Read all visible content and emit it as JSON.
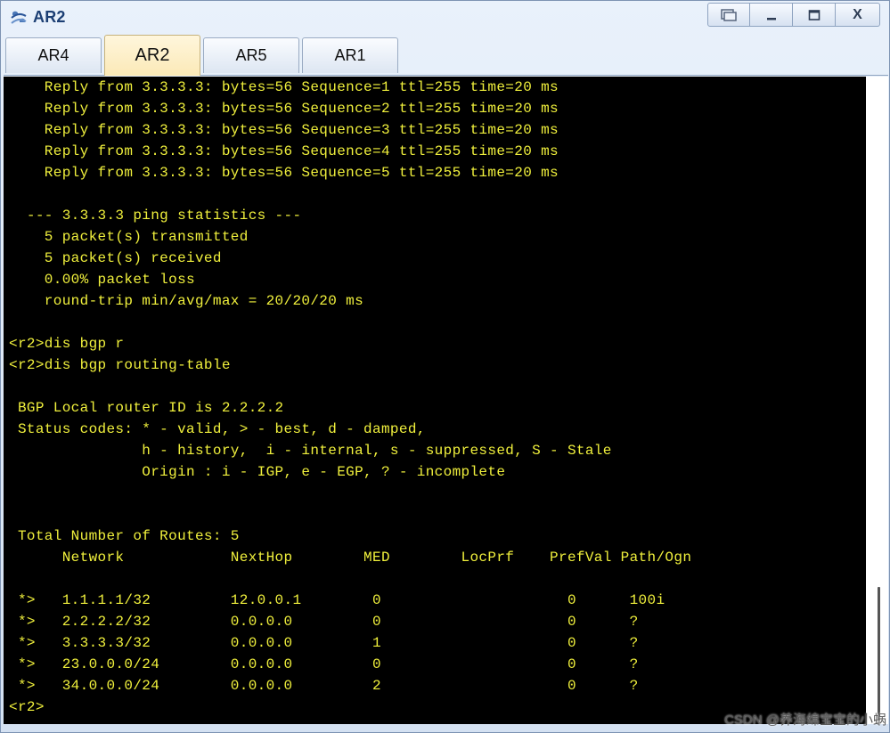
{
  "window": {
    "title": "AR2",
    "icon": "router-icon",
    "controls": [
      "restore-icon",
      "minimize-icon",
      "maximize-icon",
      "close-icon"
    ],
    "close_label": "X"
  },
  "tabs": [
    {
      "label": "AR4",
      "active": false
    },
    {
      "label": "AR2",
      "active": true
    },
    {
      "label": "AR5",
      "active": false
    },
    {
      "label": "AR1",
      "active": false
    }
  ],
  "terminal": {
    "lines": [
      "    Reply from 3.3.3.3: bytes=56 Sequence=1 ttl=255 time=20 ms",
      "    Reply from 3.3.3.3: bytes=56 Sequence=2 ttl=255 time=20 ms",
      "    Reply from 3.3.3.3: bytes=56 Sequence=3 ttl=255 time=20 ms",
      "    Reply from 3.3.3.3: bytes=56 Sequence=4 ttl=255 time=20 ms",
      "    Reply from 3.3.3.3: bytes=56 Sequence=5 ttl=255 time=20 ms",
      "",
      "  --- 3.3.3.3 ping statistics ---",
      "    5 packet(s) transmitted",
      "    5 packet(s) received",
      "    0.00% packet loss",
      "    round-trip min/avg/max = 20/20/20 ms",
      "",
      "<r2>dis bgp r",
      "<r2>dis bgp routing-table",
      "",
      " BGP Local router ID is 2.2.2.2",
      " Status codes: * - valid, > - best, d - damped,",
      "               h - history,  i - internal, s - suppressed, S - Stale",
      "               Origin : i - IGP, e - EGP, ? - incomplete",
      "",
      "",
      " Total Number of Routes: 5",
      "      Network            NextHop        MED        LocPrf    PrefVal Path/Ogn",
      "",
      " *>   1.1.1.1/32         12.0.0.1        0                     0      100i",
      " *>   2.2.2.2/32         0.0.0.0         0                     0      ?",
      " *>   3.3.3.3/32         0.0.0.0         1                     0      ?",
      " *>   23.0.0.0/24        0.0.0.0         0                     0      ?",
      " *>   34.0.0.0/24        0.0.0.0         2                     0      ?",
      "<r2>"
    ]
  },
  "watermark": "CSDN @养海绵宝宝的小蜗"
}
